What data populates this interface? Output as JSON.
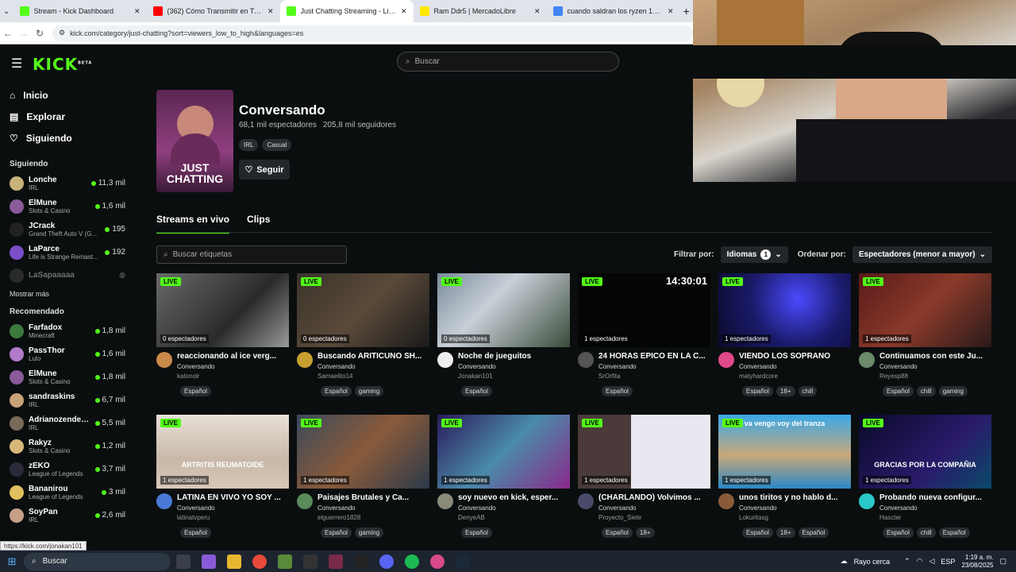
{
  "browser": {
    "tabs": [
      {
        "title": "Stream - Kick Dashboard",
        "color": "#53fc18"
      },
      {
        "title": "(362) Cómo Transmitir en Tiktok",
        "color": "#ff0000"
      },
      {
        "title": "Just Chatting Streaming - Live",
        "color": "#53fc18",
        "active": true
      },
      {
        "title": "Ram Ddr5 | MercadoLibre",
        "color": "#ffe600"
      },
      {
        "title": "cuando saldran los ryzen 10000",
        "color": "#4285f4"
      }
    ],
    "new_tab": "+",
    "url": "kick.com/category/just-chatting?sort=viewers_low_to_high&languages=es"
  },
  "header": {
    "logo": "KICK",
    "logo_sup": "BETA",
    "search_placeholder": "Buscar"
  },
  "sidebar": {
    "nav": [
      {
        "label": "Inicio",
        "icon": "home-icon",
        "glyph": "⌂"
      },
      {
        "label": "Explorar",
        "icon": "browse-icon",
        "glyph": "▤"
      },
      {
        "label": "Siguiendo",
        "icon": "heart-icon",
        "glyph": "♡"
      }
    ],
    "following_title": "Siguiendo",
    "following": [
      {
        "name": "Lonche",
        "cat": "IRL",
        "viewers": "11,3 mil",
        "color": "#c9b27a"
      },
      {
        "name": "ElMune",
        "cat": "Slots & Casino",
        "viewers": "1,6 mil",
        "color": "#8a5a9a"
      },
      {
        "name": "JCrack",
        "cat": "Grand Theft Auto V (G...",
        "viewers": "195",
        "color": "#222222"
      },
      {
        "name": "LaParce",
        "cat": "Life is Strange Remast...",
        "viewers": "192",
        "color": "#7a4ec8"
      },
      {
        "name": "LaSapaaaaa",
        "cat": "",
        "viewers": "",
        "color": "#555555",
        "offline": true
      }
    ],
    "show_more": "Mostrar más",
    "recommended_title": "Recomendado",
    "recommended": [
      {
        "name": "Farfadox",
        "cat": "Minecraft",
        "viewers": "1,8 mil",
        "color": "#3d7a3d"
      },
      {
        "name": "PassThor",
        "cat": "Luto",
        "viewers": "1,6 mil",
        "color": "#b07ac8"
      },
      {
        "name": "ElMune",
        "cat": "Slots & Casino",
        "viewers": "1,8 mil",
        "color": "#8a5a9a"
      },
      {
        "name": "sandraskins",
        "cat": "IRL",
        "viewers": "6,7 mil",
        "color": "#c9a27a"
      },
      {
        "name": "Adrianozendeja...",
        "cat": "IRL",
        "viewers": "5,5 mil",
        "color": "#7a6a5a"
      },
      {
        "name": "Rakyz",
        "cat": "Slots & Casino",
        "viewers": "1,2 mil",
        "color": "#d8b87a"
      },
      {
        "name": "zEKO",
        "cat": "League of Legends",
        "viewers": "3,7 mil",
        "color": "#2a2a3a"
      },
      {
        "name": "Bananirou",
        "cat": "League of Legends",
        "viewers": "3 mil",
        "color": "#e0c060"
      },
      {
        "name": "SoyPan",
        "cat": "IRL",
        "viewers": "2,6 mil",
        "color": "#c8a088"
      }
    ]
  },
  "category": {
    "cover_text": "JUST CHATTING",
    "title": "Conversando",
    "viewers": "68,1 mil espectadores",
    "followers": "205,8 mil seguidores",
    "tags": [
      "IRL",
      "Casual"
    ],
    "follow_label": "Seguir",
    "tabs": [
      "Streams en vivo",
      "Clips"
    ],
    "tag_search_placeholder": "Buscar etiquetas",
    "filter_label": "Filtrar por:",
    "filter_value": "Idiomas",
    "filter_count": "1",
    "sort_label": "Ordenar por:",
    "sort_value": "Espectadores (menor a mayor)"
  },
  "streams": [
    {
      "title": "reaccionando al ice verg...",
      "cat": "Conversando",
      "user": "katonolr",
      "viewers": "0 espectadores",
      "tags": [
        "Español"
      ],
      "bg": "linear-gradient(135deg,#6a6a6a,#2a2a2a 60%,#9a9a9a)",
      "av": "#c98a4a"
    },
    {
      "title": "Buscando ARITICUNO SH...",
      "cat": "Conversando",
      "user": "Samaelito14",
      "viewers": "0 espectadores",
      "tags": [
        "Español",
        "gaming"
      ],
      "bg": "linear-gradient(135deg,#3a332a,#5a4a3a 50%,#1a1a1a)",
      "av": "#c8a030"
    },
    {
      "title": "Noche de jueguitos",
      "cat": "Conversando",
      "user": "Jonakan101",
      "viewers": "0 espectadores",
      "tags": [
        "Español"
      ],
      "bg": "linear-gradient(135deg,#7a8a9a,#c8d0d8 40%,#3a4a3a)",
      "av": "#eeeeee"
    },
    {
      "title": "24 HORAS EPICO EN LA C...",
      "cat": "Conversando",
      "user": "SrOrfita",
      "viewers": "1 espectadores",
      "tags": [
        "Español"
      ],
      "bg": "#050505",
      "av": "#555555",
      "timer": "14:30:01"
    },
    {
      "title": "VIENDO LOS SOPRANO",
      "cat": "Conversando",
      "user": "matyhardcore",
      "viewers": "1 espectadores",
      "tags": [
        "Español",
        "18+",
        "chill"
      ],
      "bg": "radial-gradient(circle at 60% 35%,#4a4aff,#1a1a6a 50%,#0a0a2a)",
      "av": "#e04a8a"
    },
    {
      "title": "Continuamos con este Ju...",
      "cat": "Conversando",
      "user": "Reyesp88",
      "viewers": "1 espectadores",
      "tags": [
        "Español",
        "chill",
        "gaming"
      ],
      "bg": "linear-gradient(135deg,#5a1a1a,#8a3a2a 50%,#2a1a1a)",
      "av": "#6a8a6a"
    },
    {
      "title": "LATINA EN VIVO YO SOY ...",
      "cat": "Conversando",
      "user": "latinatvperu",
      "viewers": "1 espectadores",
      "tags": [
        "Español"
      ],
      "bg": "linear-gradient(180deg,#e8e0d8,#c8b8a8 60%,#d8c8b8)",
      "av": "#4a7ad8",
      "overlay": "ARTRITIS REUMATOIDE"
    },
    {
      "title": "Paisajes Brutales y Ca...",
      "cat": "Conversando",
      "user": "elguerrero1828",
      "viewers": "1 espectadores",
      "tags": [
        "Español",
        "gaming"
      ],
      "bg": "linear-gradient(135deg,#3a4a5a,#8a5a3a 50%,#2a3a4a)",
      "av": "#5a8a5a"
    },
    {
      "title": "soy nuevo en kick, esper...",
      "cat": "Conversando",
      "user": "DenyeAB",
      "viewers": "1 espectadores",
      "tags": [
        "Español"
      ],
      "bg": "linear-gradient(135deg,#2a1a5a,#4a8aaa 50%,#8a2a8a)",
      "av": "#8a8a7a"
    },
    {
      "title": "(CHARLANDO) Volvimos ...",
      "cat": "Conversando",
      "user": "Proyecto_Siete",
      "viewers": "1 espectadores",
      "tags": [
        "Español",
        "18+"
      ],
      "bg": "linear-gradient(90deg,#4a3a3a 40%,#e8e8f0 40%)",
      "av": "#4a4a6a"
    },
    {
      "title": "unos tiritos y no hablo d...",
      "cat": "Conversando",
      "user": "Lokuritasg",
      "viewers": "1 espectadores",
      "tags": [
        "Español",
        "18+",
        "Español"
      ],
      "bg": "linear-gradient(180deg,#3aa8e8,#c8a878 55%,#2a88c8)",
      "av": "#8a5a3a",
      "overlay_top": "va vengo voy del tranza"
    },
    {
      "title": "Probando nueva configur...",
      "cat": "Conversando",
      "user": "Hascter",
      "viewers": "1 espectadores",
      "tags": [
        "Español",
        "chill",
        "Español"
      ],
      "bg": "linear-gradient(135deg,#0a0a2a,#2a1a6a 60%,#0a4a6a)",
      "av": "#2ac8c8",
      "overlay": "GRACIAS POR LA COMPAÑIA"
    }
  ],
  "status_url": "https://kick.com/jonakan101",
  "taskbar": {
    "search": "Buscar",
    "weather": "Rayo cerca",
    "lang": "ESP",
    "time": "1:19 a. m.",
    "date": "23/08/2025"
  }
}
